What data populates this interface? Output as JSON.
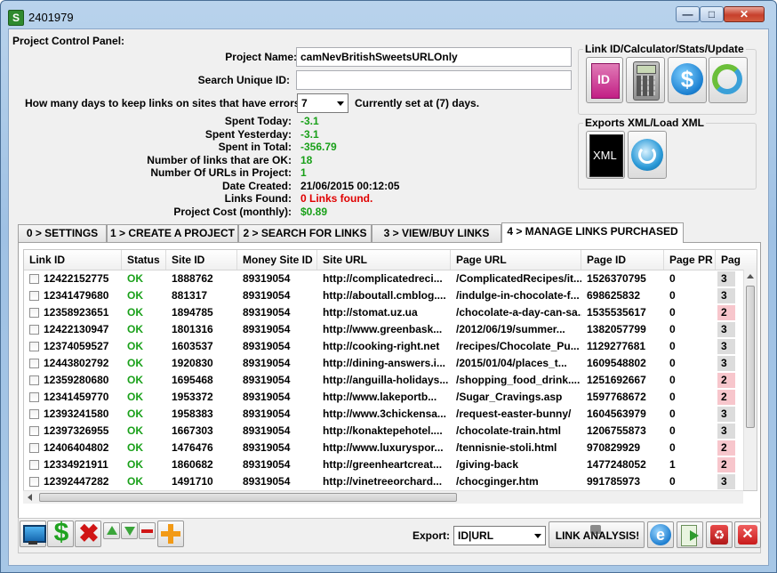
{
  "window": {
    "title": "2401979",
    "app_icon": "S"
  },
  "panel": {
    "title": "Project Control Panel:",
    "project_name_label": "Project Name:",
    "project_name_value": "camNevBritishSweetsURLOnly",
    "search_id_label": "Search Unique ID:",
    "search_id_value": "",
    "days_label": "How many days to keep links on sites that have errors:",
    "days_value": "7",
    "days_current": "Currently set at (7) days."
  },
  "stats": [
    {
      "label": "Spent Today:",
      "value": "-3.1",
      "color": "green"
    },
    {
      "label": "Spent Yesterday:",
      "value": "-3.1",
      "color": "green"
    },
    {
      "label": "Spent in Total:",
      "value": "-356.79",
      "color": "green"
    },
    {
      "label": "Number of links that are OK:",
      "value": "18",
      "color": "green"
    },
    {
      "label": "Number Of URLs in Project:",
      "value": "1",
      "color": "green"
    },
    {
      "label": "Date Created:",
      "value": "21/06/2015 00:12:05",
      "color": "black"
    },
    {
      "label": "Links Found:",
      "value": "0 Links found.",
      "color": "red"
    },
    {
      "label": "Project Cost (monthly):",
      "value": "$0.89",
      "color": "green"
    }
  ],
  "groups": {
    "linkid_title": "Link ID/Calculator/Stats/Update",
    "exports_title": "Exports XML/Load XML",
    "id_icon_text": "ID",
    "xml_icon_text": "XML"
  },
  "tabs": [
    {
      "label": "0 > SETTINGS"
    },
    {
      "label": "1 > CREATE A PROJECT"
    },
    {
      "label": "2 > SEARCH FOR LINKS"
    },
    {
      "label": "3 > VIEW/BUY LINKS"
    },
    {
      "label": "4 > MANAGE LINKS PURCHASED"
    }
  ],
  "table": {
    "columns": [
      "Link ID",
      "Status",
      "Site ID",
      "Money Site ID",
      "Site URL",
      "Page URL",
      "Page ID",
      "Page PR",
      "Pag"
    ],
    "rows": [
      [
        "12422152775",
        "OK",
        "1888762",
        "89319054",
        "http://complicatedreci...",
        "/ComplicatedRecipes/it...",
        "1526370795",
        "0",
        "3"
      ],
      [
        "12341479680",
        "OK",
        "881317",
        "89319054",
        "http://aboutall.cmblog....",
        "/indulge-in-chocolate-f...",
        "698625832",
        "0",
        "3"
      ],
      [
        "12358923651",
        "OK",
        "1894785",
        "89319054",
        "http://stomat.uz.ua",
        "/chocolate-a-day-can-sa...",
        "1535535617",
        "0",
        "2"
      ],
      [
        "12422130947",
        "OK",
        "1801316",
        "89319054",
        "http://www.greenbask...",
        "/2012/06/19/summer...",
        "1382057799",
        "0",
        "3"
      ],
      [
        "12374059527",
        "OK",
        "1603537",
        "89319054",
        "http://cooking-right.net",
        "/recipes/Chocolate_Pu...",
        "1129277681",
        "0",
        "3"
      ],
      [
        "12443802792",
        "OK",
        "1920830",
        "89319054",
        "http://dining-answers.i...",
        "/2015/01/04/places_t...",
        "1609548802",
        "0",
        "3"
      ],
      [
        "12359280680",
        "OK",
        "1695468",
        "89319054",
        "http://anguilla-holidays...",
        "/shopping_food_drink....",
        "1251692667",
        "0",
        "2"
      ],
      [
        "12341459770",
        "OK",
        "1953372",
        "89319054",
        "http://www.lakeportb...",
        "/Sugar_Cravings.asp",
        "1597768672",
        "0",
        "2"
      ],
      [
        "12393241580",
        "OK",
        "1958383",
        "89319054",
        "http://www.3chickensa...",
        "/request-easter-bunny/",
        "1604563979",
        "0",
        "3"
      ],
      [
        "12397326955",
        "OK",
        "1667303",
        "89319054",
        "http://konaktepehotel....",
        "/chocolate-train.html",
        "1206755873",
        "0",
        "3"
      ],
      [
        "12406404802",
        "OK",
        "1476476",
        "89319054",
        "http://www.luxuryspor...",
        "/tennisnie-stoli.html",
        "970829929",
        "0",
        "2"
      ],
      [
        "12334921911",
        "OK",
        "1860682",
        "89319054",
        "http://greenheartcreat...",
        "/giving-back",
        "1477248052",
        "1",
        "2"
      ],
      [
        "12392447282",
        "OK",
        "1491710",
        "89319054",
        "http://vinetreeorchard...",
        "/chocginger.htm",
        "991785973",
        "0",
        "3"
      ]
    ]
  },
  "bottom": {
    "export_label": "Export:",
    "export_value": "ID|URL",
    "link_analysis_label": "LINK ANALYSIS!"
  },
  "colors": {
    "ok_green": "#19a019",
    "error_red": "#e00000",
    "pr_pink": "#f7c6cc",
    "pr_gray": "#dcdcdc"
  }
}
